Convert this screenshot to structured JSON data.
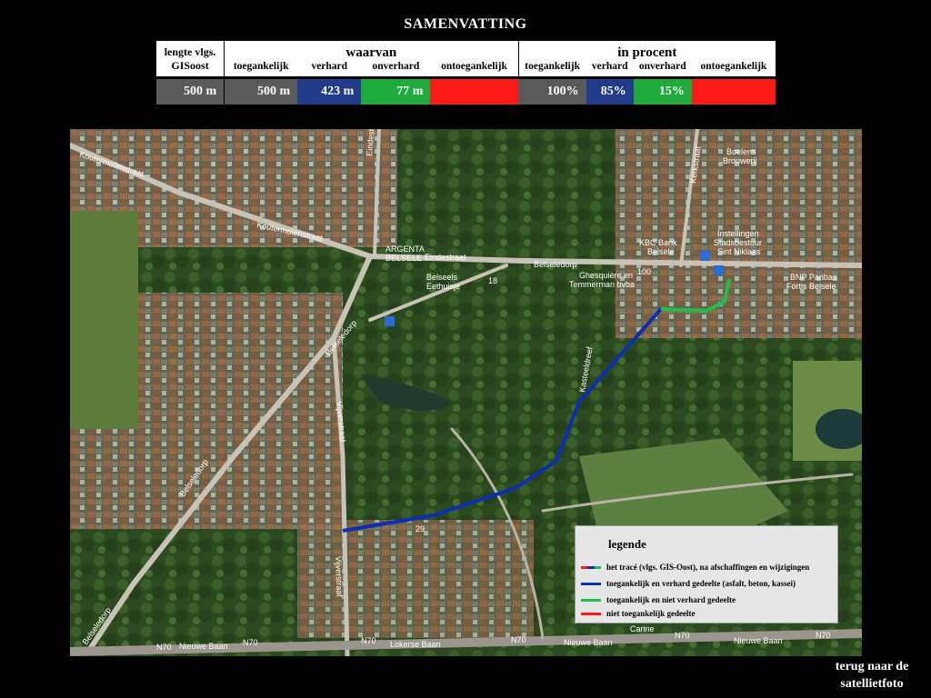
{
  "title": "SAMENVATTING",
  "summary": {
    "length_header": "lengte vlgs.",
    "length_header2": "GISoost",
    "group_waarvan": "waarvan",
    "group_procent": "in procent",
    "columns": [
      "toegankelijk",
      "verhard",
      "onverhard",
      "ontoegankelijk"
    ],
    "values": {
      "length": "500 m",
      "toegankelijk": "500 m",
      "verhard": "423 m",
      "onverhard": "77 m",
      "ontoegankelijk": "",
      "pct_toegankelijk": "100%",
      "pct_verhard": "85%",
      "pct_onverhard": "15%",
      "pct_ontoegankelijk": ""
    },
    "colors": {
      "grey": "#5a5a5a",
      "blue": "#1f3b8a",
      "green": "#1faa3c",
      "red": "#ff1a1a"
    }
  },
  "map": {
    "labels": {
      "koutermolenstraat_w": "Koutermolenstraat",
      "koutermolenstraat": "Koutermolenstraat",
      "eindestraat": "Eindestraat",
      "eindestraat_n": "Eindestraat",
      "belseledorp_n": "Belseledorp",
      "belseledorp_w": "Belseledorp",
      "belseledorp_sw": "Belseledorp",
      "belseledorp_s": "Belseledorp",
      "vijverstraat": "Vijverstraat",
      "vijverstraat_n": "Vijverstraat",
      "kasteeldreef": "Kasteeldreef",
      "kerkstraat": "Kerkstraat",
      "argenta": "ARGENTA",
      "belsele": "BELSELE",
      "belseels": "Belseels",
      "eethuisje": "Eethuisje",
      "ghesquiere": "Ghesquière en",
      "temmerman": "Temmerman bvba",
      "kbc": "KBC Bank",
      "kbc2": "Belsele",
      "instellingen": "Instellingen",
      "stadsbestuur": "Stadsbestuur",
      "sintniklaas": "Sint Niklaas",
      "bnp": "BNP Paribas",
      "fortis": "Fortis Belsele",
      "boelens": "Boelens",
      "brouwerij": "Brouwerij",
      "nieuwe_baan_w": "Nieuwe Baan",
      "lokerse_baan": "Lokerse Baan",
      "nieuwe_baan": "Nieuwe Baan",
      "nieuwe_baan_e": "Nieuwe Baan",
      "n70_1": "N70",
      "n70_2": "N70",
      "n70_3": "N70",
      "n70_4": "N70",
      "n70_5": "N70",
      "n70_6": "N70",
      "carine": "Carine",
      "num_100": "100",
      "num_18": "18",
      "num_29": "29"
    },
    "route_colors": {
      "paved": "#0a2fb0",
      "unpaved": "#1fbf4a"
    }
  },
  "legend": {
    "title": "legende",
    "items": [
      "het tracé (vlgs. GIS-Oost), na afschaffingen en wijzigingen",
      "toegankelijk en verhard gedeelte (asfalt, beton, kassei)",
      "toegankelijk en niet verhard gedeelte",
      "niet toegankelijk gedeelte"
    ],
    "colors": [
      "#0a2fb0",
      "#1fbf4a",
      "#ff1a1a"
    ]
  },
  "back_link": {
    "line1": "terug naar de",
    "line2": "satellietfoto"
  }
}
